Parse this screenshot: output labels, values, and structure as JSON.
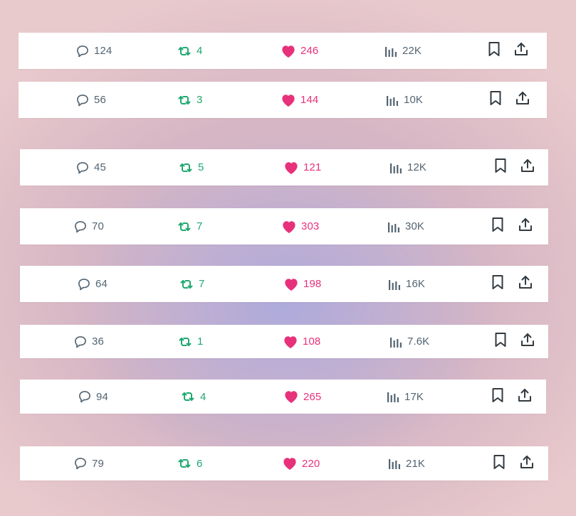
{
  "colors": {
    "icon_gray": "#536471",
    "repost_green": "#1fa870",
    "like_pink": "#e7317a",
    "bar_bg": "#ffffff"
  },
  "icons": {
    "reply": "comment-bubble-icon",
    "repost": "repost-arrows-icon",
    "like": "heart-filled-icon",
    "views": "bar-chart-icon",
    "bookmark": "bookmark-icon",
    "share": "share-upload-icon"
  },
  "rows": [
    {
      "replies": "124",
      "reposts": "4",
      "likes": "246",
      "views": "22K"
    },
    {
      "replies": "56",
      "reposts": "3",
      "likes": "144",
      "views": "10K"
    },
    {
      "replies": "45",
      "reposts": "5",
      "likes": "121",
      "views": "12K"
    },
    {
      "replies": "70",
      "reposts": "7",
      "likes": "303",
      "views": "30K"
    },
    {
      "replies": "64",
      "reposts": "7",
      "likes": "198",
      "views": "16K"
    },
    {
      "replies": "36",
      "reposts": "1",
      "likes": "108",
      "views": "7.6K"
    },
    {
      "replies": "94",
      "reposts": "4",
      "likes": "265",
      "views": "17K"
    },
    {
      "replies": "79",
      "reposts": "6",
      "likes": "220",
      "views": "21K"
    }
  ]
}
